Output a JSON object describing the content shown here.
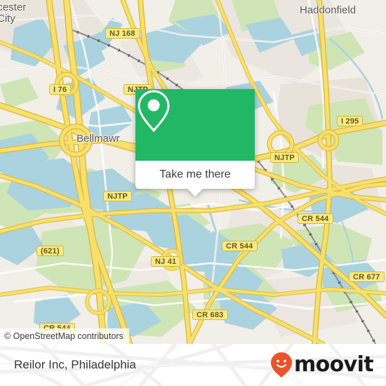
{
  "map": {
    "attribution": "© OpenStreetMap contributors",
    "places": [
      {
        "name": "Gloucester City",
        "display": "ucester\nCity"
      },
      {
        "name": "Bellmawr",
        "display": "Bellmawr"
      },
      {
        "name": "Haddonfield",
        "display": "Haddonfield"
      }
    ],
    "place_labels": {
      "gloucester_line1": "ucester",
      "gloucester_line2": "City",
      "bellmawr": "Bellmawr",
      "haddonfield": "Haddonfield"
    },
    "road_shields": [
      {
        "label": "NJ 168"
      },
      {
        "label": "I 76"
      },
      {
        "label": "I 295"
      },
      {
        "label": "NJTP"
      },
      {
        "label": "NJTP"
      },
      {
        "label": "NJTP"
      },
      {
        "label": "CR 544"
      },
      {
        "label": "CR 544"
      },
      {
        "label": "CR 544"
      },
      {
        "label": "CR 677"
      },
      {
        "label": "CR 683"
      },
      {
        "label": "NJ 41"
      },
      {
        "label": "(621)"
      }
    ],
    "shield_labels": {
      "nj168": "NJ 168",
      "i76": "I 76",
      "i295": "I 295",
      "njtp_mid": "NJTP",
      "njtp_left": "NJTP",
      "njtp_low": "NJTP",
      "cr544_a": "CR 544",
      "cr544_b": "CR 544",
      "cr544_c": "CR 544",
      "cr677": "CR 677",
      "cr683": "CR 683",
      "nj41": "NJ 41",
      "cr621": "(621)"
    },
    "colors": {
      "land": "#f2efe9",
      "water": "#aad3df",
      "park": "#cfe5b5",
      "residential": "#e9e3dc",
      "industrial": "#ece7e4",
      "motorway": "#f7e06e",
      "motorway_casing": "#e3c44a",
      "minor_road": "#ffffff",
      "rail": "#8a8a8a",
      "shield_fill": "#f7e98a",
      "shield_border": "#d4b92e",
      "shield_text": "#6b5a10",
      "label_text": "#5a5a5a"
    }
  },
  "popup": {
    "icon": "map-pin-icon",
    "button_label": "Take me there",
    "accent_color": "#22b765"
  },
  "footer": {
    "title": "Reilor Inc, Philadelphia",
    "brand": "moovit",
    "brand_color": "#e8532b",
    "brand_text_color": "#1a1a1a"
  }
}
